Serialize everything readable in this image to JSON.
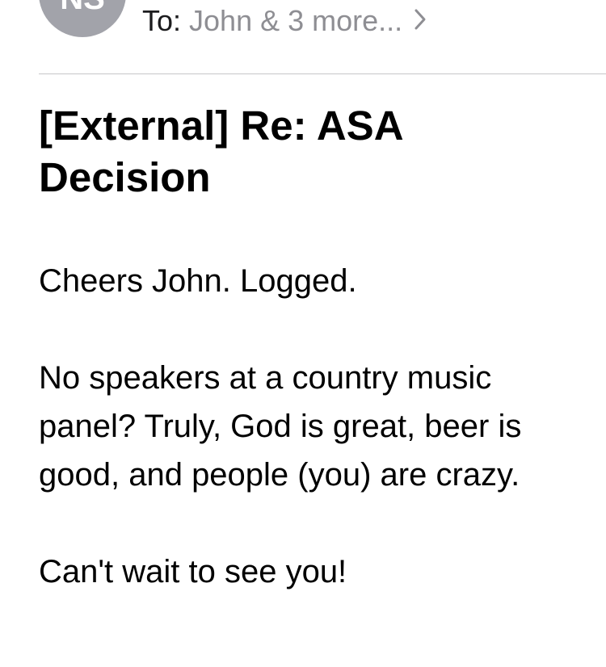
{
  "header": {
    "avatar_initials": "NS",
    "to_label": "To:",
    "to_value": "John & 3 more...",
    "chevron_icon": "chevron-right-icon"
  },
  "message": {
    "subject": "[External] Re: ASA Decision",
    "paragraphs": [
      "Cheers John. Logged.",
      "No speakers at a country music panel? Truly, God is great, beer is good, and people (you) are crazy.",
      "Can't wait to see you!"
    ]
  },
  "colors": {
    "avatar_bg": "#a2a3aa",
    "secondary_text": "#8e8e93",
    "divider": "#c6c6c8"
  }
}
